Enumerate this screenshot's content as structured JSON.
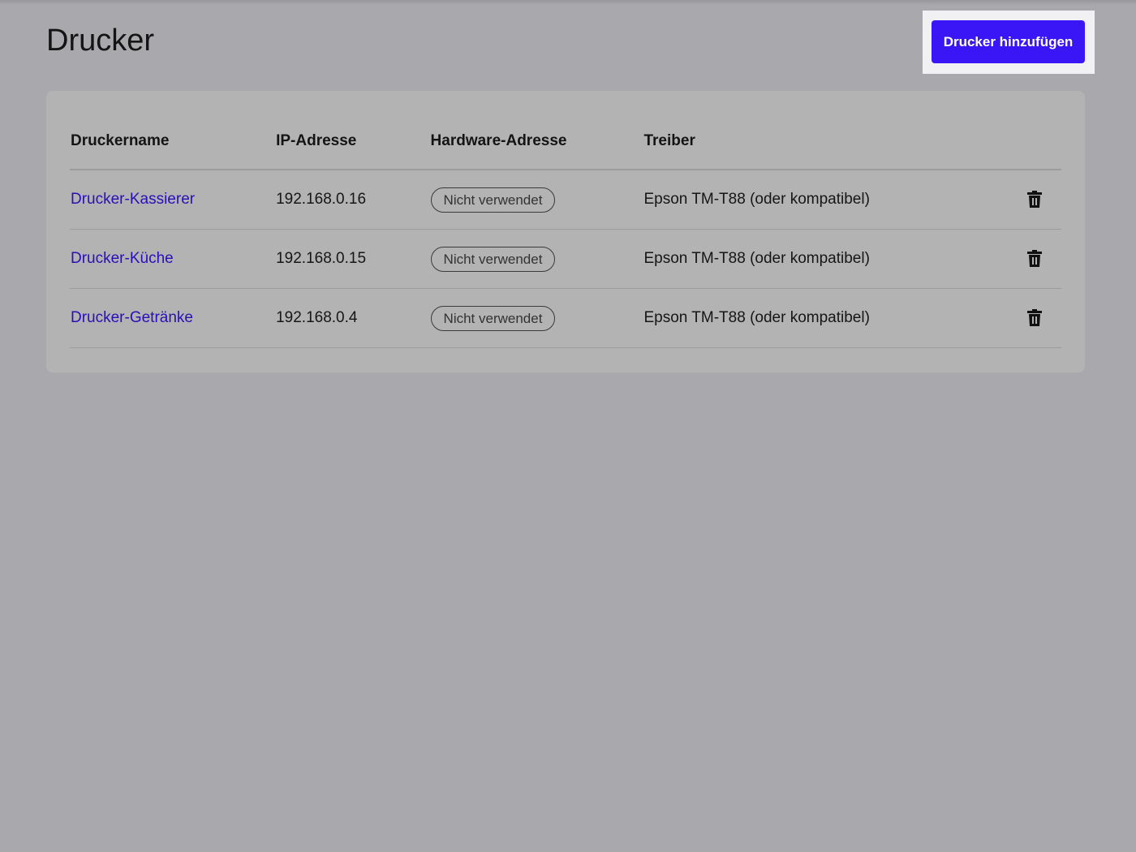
{
  "page": {
    "title": "Drucker",
    "add_button_label": "Drucker hinzufügen"
  },
  "table": {
    "headers": {
      "name": "Druckername",
      "ip": "IP-Adresse",
      "hardware": "Hardware-Adresse",
      "driver": "Treiber"
    },
    "rows": [
      {
        "name": "Drucker-Kassierer",
        "ip": "192.168.0.16",
        "hardware": "Nicht verwendet",
        "driver": "Epson TM-T88 (oder kompatibel)"
      },
      {
        "name": "Drucker-Küche",
        "ip": "192.168.0.15",
        "hardware": "Nicht verwendet",
        "driver": "Epson TM-T88 (oder kompatibel)"
      },
      {
        "name": "Drucker-Getränke",
        "ip": "192.168.0.4",
        "hardware": "Nicht verwendet",
        "driver": "Epson TM-T88 (oder kompatibel)"
      }
    ]
  },
  "icons": {
    "delete": "trash-icon"
  },
  "colors": {
    "accent": "#3a16f7",
    "link": "#2810b8",
    "overlay_background": "#a9a8ad",
    "card_background": "#b3b3b3",
    "spotlight_background": "#f1f1f4"
  }
}
